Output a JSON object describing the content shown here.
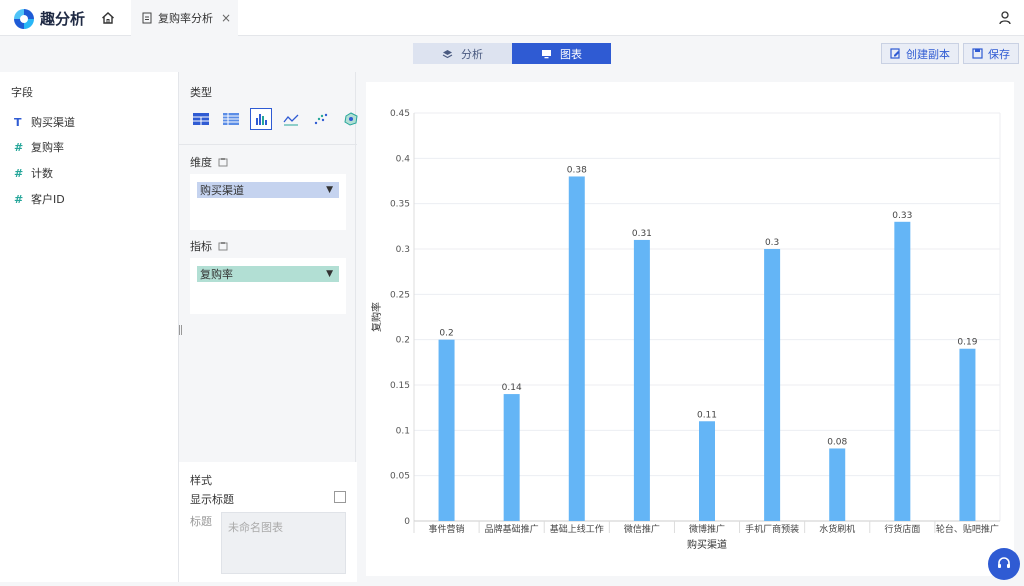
{
  "app": {
    "name": "趣分析"
  },
  "tab": {
    "label": "复购率分析",
    "close": "×"
  },
  "switch": {
    "analysis": "分析",
    "chart": "图表"
  },
  "actions": {
    "copy": "创建副本",
    "save": "保存"
  },
  "fields": {
    "title": "字段",
    "items": [
      {
        "type": "T",
        "label": "购买渠道"
      },
      {
        "type": "#",
        "label": "复购率"
      },
      {
        "type": "#",
        "label": "计数"
      },
      {
        "type": "#",
        "label": "客户ID"
      }
    ]
  },
  "config": {
    "type_label": "类型",
    "types": [
      "table-icon",
      "pivot-table-icon",
      "bar-chart-icon",
      "line-chart-icon",
      "scatter-chart-icon",
      "map-icon"
    ],
    "selected_type": "bar-chart-icon",
    "dimension_label": "维度",
    "dimension_value": "购买渠道",
    "metric_label": "指标",
    "metric_value": "复购率",
    "style_label": "样式",
    "show_title_label": "显示标题",
    "title_label": "标题",
    "title_placeholder": "未命名图表"
  },
  "colors": {
    "bar": "#64b5f6",
    "accent": "#2f5bd3"
  },
  "chart_data": {
    "type": "bar",
    "categories": [
      "事件营销",
      "品牌基础推广",
      "基础上线工作",
      "微信推广",
      "微博推广",
      "手机厂商预装",
      "水货刷机",
      "行货店面",
      "轮台、贴吧推广"
    ],
    "values": [
      0.2,
      0.14,
      0.38,
      0.31,
      0.11,
      0.3,
      0.08,
      0.33,
      0.19
    ],
    "data_labels": [
      "0.2",
      "0.14",
      "0.38",
      "0.31",
      "0.11",
      "0.3",
      "0.08",
      "0.33",
      "0.19"
    ],
    "yticks": [
      "0",
      "0.05",
      "0.1",
      "0.15",
      "0.2",
      "0.25",
      "0.3",
      "0.35",
      "0.4",
      "0.45"
    ],
    "ylim": [
      0,
      0.45
    ],
    "xlabel": "购买渠道",
    "ylabel": "复购率",
    "grid": true
  }
}
